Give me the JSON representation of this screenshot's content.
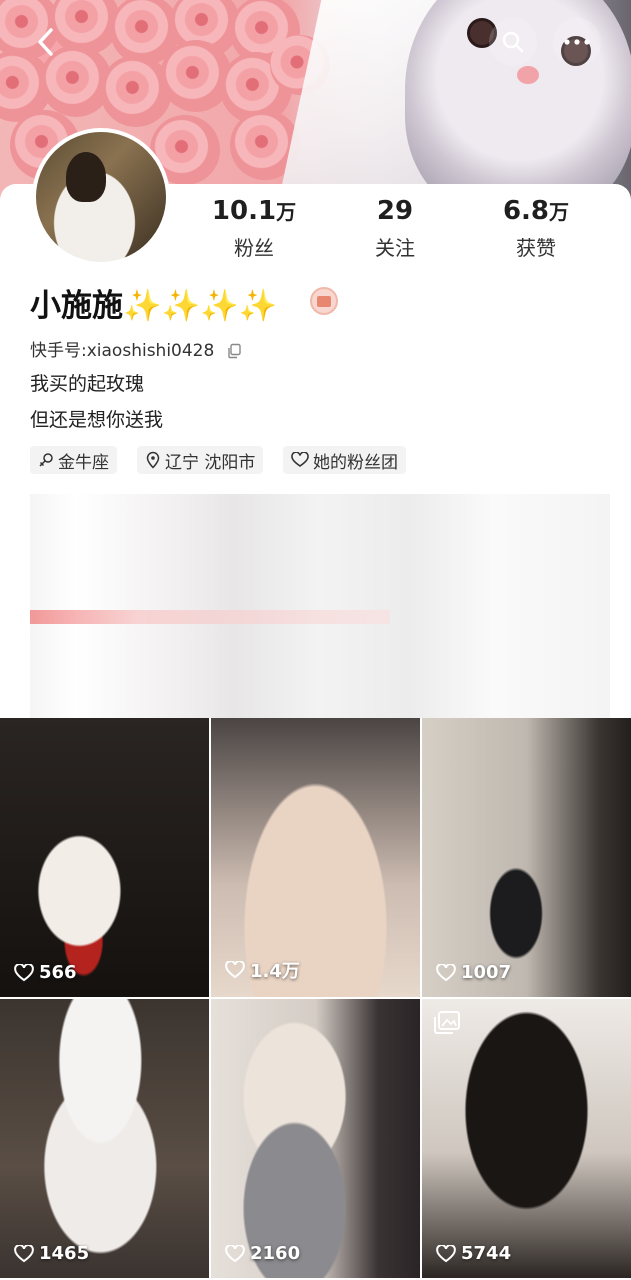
{
  "profile": {
    "name": "小施施✨✨✨✨",
    "kuaishou_id_label": "快手号:",
    "kuaishou_id": "xiaoshishi0428",
    "bio_line1": "我买的起玫瑰",
    "bio_line2": "但还是想你送我"
  },
  "stats": [
    {
      "value": "10.1",
      "unit": "万",
      "label": "粉丝"
    },
    {
      "value": "29",
      "unit": "",
      "label": "关注"
    },
    {
      "value": "6.8",
      "unit": "万",
      "label": "获赞"
    }
  ],
  "tags": [
    {
      "icon": "female-symbol-icon",
      "label": "金牛座"
    },
    {
      "icon": "location-pin-icon",
      "label": "辽宁 沈阳市"
    },
    {
      "icon": "heart-outline-icon",
      "label": "她的粉丝团"
    }
  ],
  "posts": [
    {
      "likes": "566"
    },
    {
      "likes": "1.4万"
    },
    {
      "likes": "1007"
    },
    {
      "likes": "1465"
    },
    {
      "likes": "2160"
    },
    {
      "likes": "5744",
      "album": true
    }
  ],
  "icons": {
    "back": "chevron-left-icon",
    "search": "search-icon",
    "more": "more-dots-icon",
    "copy": "copy-icon",
    "heart": "heart-outline-icon",
    "album": "album-icon"
  },
  "colors": {
    "badge": "#e7876f",
    "tag_bg": "#f3f3f3"
  }
}
